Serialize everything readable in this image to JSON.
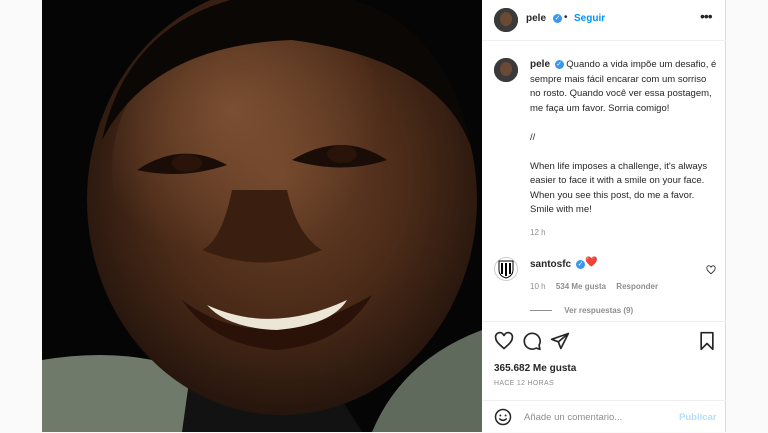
{
  "post_header": {
    "username": "pele",
    "separator": "•",
    "follow_label": "Seguir",
    "more_icon": "more-horizontal-icon"
  },
  "caption": {
    "username": "pele",
    "text_pt": "Quando a vida impõe um desafio, é sempre mais fácil encarar com um sorriso no rosto. Quando você ver essa postagem, me faça um favor. Sorria comigo!",
    "divider": "//",
    "text_en": "When life imposes a challenge, it's always easier to face it with a smile on your face. When you see this post, do me a favor. Smile with me!",
    "time": "12 h"
  },
  "comment": {
    "username": "santosfc",
    "emoji": "❤️",
    "time": "10 h",
    "likes": "534 Me gusta",
    "reply_label": "Responder",
    "view_replies": "Ver respuestas (9)"
  },
  "actions": {
    "like_count": "365.682 Me gusta",
    "posted": "HACE 12 HORAS"
  },
  "add_comment": {
    "placeholder": "Añade un comentario...",
    "publish_label": "Publicar"
  },
  "colors": {
    "accent": "#0095f6",
    "verified": "#3897f0",
    "heart": "#e0245e",
    "muted": "#8e8e8e"
  }
}
